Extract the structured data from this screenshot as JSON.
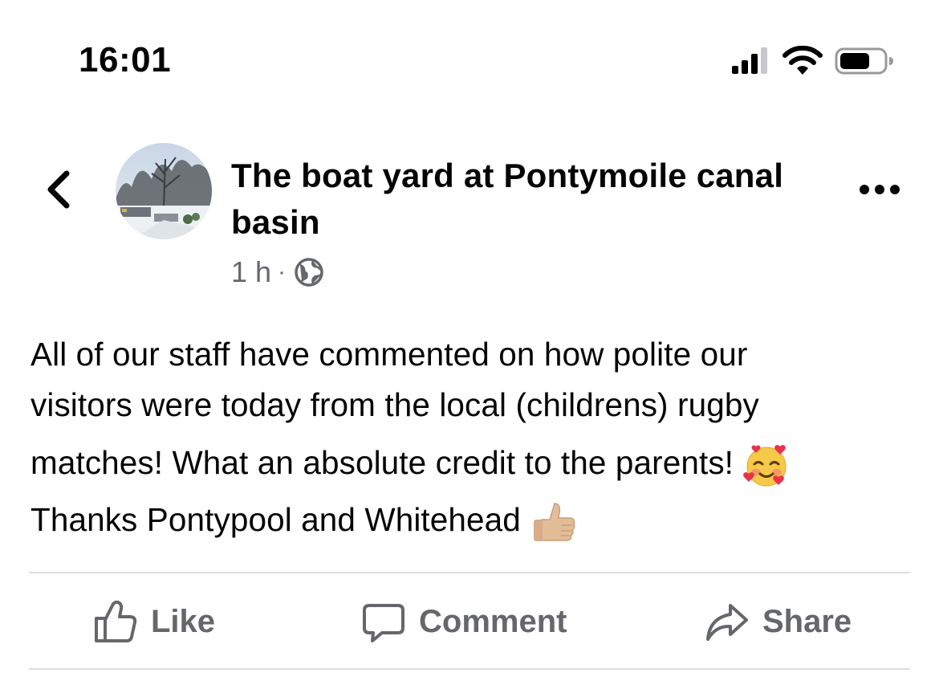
{
  "status_bar": {
    "time": "16:01",
    "icons": [
      "signal-icon",
      "wifi-icon",
      "battery-icon"
    ]
  },
  "header": {
    "back_icon": "chevron-left-icon",
    "avatar_alt": "avatar",
    "page_name": "The boat yard at Pontymoile canal basin",
    "time_ago": "1 h",
    "separator": "·",
    "privacy_icon": "globe-icon",
    "more_icon": "ellipsis-icon"
  },
  "post": {
    "lines": [
      "All of our staff have commented on how polite our",
      "visitors were today from the local (childrens) rugby",
      "matches!  What an absolute credit to the parents!",
      "Thanks Pontypool and Whitehead"
    ],
    "emojis": [
      "smiling-face-with-hearts-icon",
      "thumbs-up-icon"
    ]
  },
  "actions": {
    "like_label": "Like",
    "comment_label": "Comment",
    "share_label": "Share"
  },
  "colors": {
    "text": "#050505",
    "secondary_text": "#65676b",
    "divider": "#dadde1"
  }
}
